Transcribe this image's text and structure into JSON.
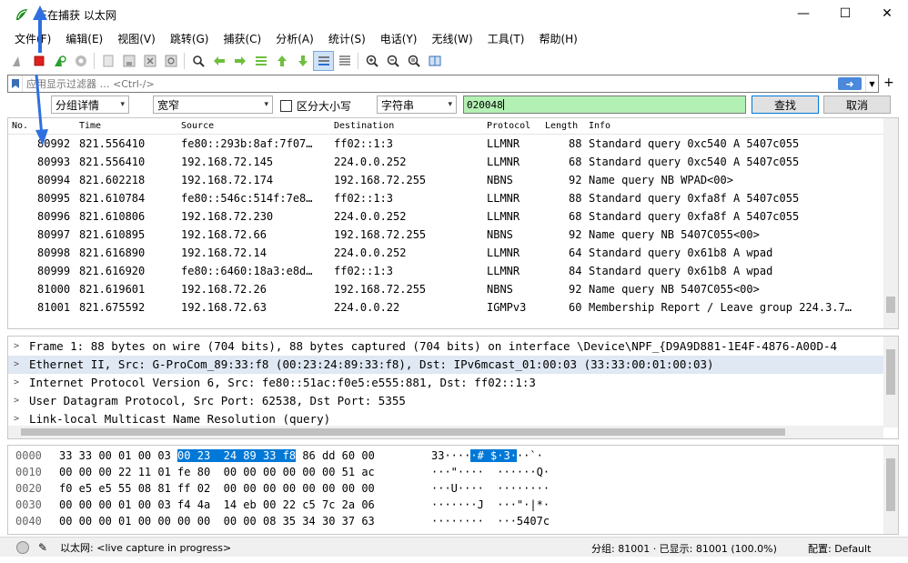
{
  "window": {
    "title": "正在捕获 以太网",
    "controls": [
      "—",
      "☐",
      "✕"
    ]
  },
  "menu": [
    "文件(F)",
    "编辑(E)",
    "视图(V)",
    "跳转(G)",
    "捕获(C)",
    "分析(A)",
    "统计(S)",
    "电话(Y)",
    "无线(W)",
    "工具(T)",
    "帮助(H)"
  ],
  "toolbar_icons": [
    "shark-fin-start-icon",
    "stop-capture-icon",
    "restart-capture-icon",
    "capture-options-icon",
    "open-file-icon",
    "save-file-icon",
    "close-file-icon",
    "reload-file-icon",
    "find-packet-icon",
    "go-back-icon",
    "go-forward-icon",
    "go-to-packet-icon",
    "go-first-icon",
    "go-last-icon",
    "autoscroll-icon",
    "colorize-icon",
    "zoom-in-icon",
    "zoom-out-icon",
    "zoom-normal-icon",
    "resize-columns-icon"
  ],
  "display_filter": {
    "placeholder": "应用显示过滤器 … <Ctrl-/>"
  },
  "find_bar": {
    "search_in": "分组详情",
    "char_width": "宽窄",
    "case_label": "区分大小写",
    "search_type": "字符串",
    "value": "020048",
    "find_button": "查找",
    "cancel_button": "取消"
  },
  "packet_list": {
    "columns": [
      "No.",
      "Time",
      "Source",
      "Destination",
      "Protocol",
      "Length",
      "Info"
    ],
    "rows": [
      {
        "no": "80992",
        "time": "821.556410",
        "src": "fe80::293b:8af:7f07…",
        "dst": "ff02::1:3",
        "proto": "LLMNR",
        "len": "88",
        "info": "Standard query 0xc540 A 5407c055"
      },
      {
        "no": "80993",
        "time": "821.556410",
        "src": "192.168.72.145",
        "dst": "224.0.0.252",
        "proto": "LLMNR",
        "len": "68",
        "info": "Standard query 0xc540 A 5407c055"
      },
      {
        "no": "80994",
        "time": "821.602218",
        "src": "192.168.72.174",
        "dst": "192.168.72.255",
        "proto": "NBNS",
        "len": "92",
        "info": "Name query NB WPAD<00>"
      },
      {
        "no": "80995",
        "time": "821.610784",
        "src": "fe80::546c:514f:7e8…",
        "dst": "ff02::1:3",
        "proto": "LLMNR",
        "len": "88",
        "info": "Standard query 0xfa8f A 5407c055"
      },
      {
        "no": "80996",
        "time": "821.610806",
        "src": "192.168.72.230",
        "dst": "224.0.0.252",
        "proto": "LLMNR",
        "len": "68",
        "info": "Standard query 0xfa8f A 5407c055"
      },
      {
        "no": "80997",
        "time": "821.610895",
        "src": "192.168.72.66",
        "dst": "192.168.72.255",
        "proto": "NBNS",
        "len": "92",
        "info": "Name query NB 5407C055<00>"
      },
      {
        "no": "80998",
        "time": "821.616890",
        "src": "192.168.72.14",
        "dst": "224.0.0.252",
        "proto": "LLMNR",
        "len": "64",
        "info": "Standard query 0x61b8 A wpad"
      },
      {
        "no": "80999",
        "time": "821.616920",
        "src": "fe80::6460:18a3:e8d…",
        "dst": "ff02::1:3",
        "proto": "LLMNR",
        "len": "84",
        "info": "Standard query 0x61b8 A wpad"
      },
      {
        "no": "81000",
        "time": "821.619601",
        "src": "192.168.72.26",
        "dst": "192.168.72.255",
        "proto": "NBNS",
        "len": "92",
        "info": "Name query NB 5407C055<00>"
      },
      {
        "no": "81001",
        "time": "821.675592",
        "src": "192.168.72.63",
        "dst": "224.0.0.22",
        "proto": "IGMPv3",
        "len": "60",
        "info": "Membership Report / Leave group 224.3.7…"
      }
    ]
  },
  "details": [
    "Frame 1: 88 bytes on wire (704 bits), 88 bytes captured (704 bits) on interface \\Device\\NPF_{D9A9D881-1E4F-4876-A00D-4",
    "Ethernet II, Src: G-ProCom_89:33:f8 (00:23:24:89:33:f8), Dst: IPv6mcast_01:00:03 (33:33:00:01:00:03)",
    "Internet Protocol Version 6, Src: fe80::51ac:f0e5:e555:881, Dst: ff02::1:3",
    "User Datagram Protocol, Src Port: 62538, Dst Port: 5355",
    "Link-local Multicast Name Resolution (query)"
  ],
  "bytes": [
    {
      "off": "0000",
      "hex_pre": "33 33 00 01 00 03 ",
      "hex_hl": "00 23  24 89 33 f8",
      "hex_post": " 86 dd 60 00",
      "asc_pre": "33····",
      "asc_hl": "·# $·3·",
      "asc_post": "··`·"
    },
    {
      "off": "0010",
      "hex_pre": "00 00 00 22 11 01 fe 80  00 00 00 00 00 00 51 ac",
      "hex_hl": "",
      "hex_post": "",
      "asc_pre": "···\"····  ······Q·",
      "asc_hl": "",
      "asc_post": ""
    },
    {
      "off": "0020",
      "hex_pre": "f0 e5 e5 55 08 81 ff 02  00 00 00 00 00 00 00 00",
      "hex_hl": "",
      "hex_post": "",
      "asc_pre": "···U····  ········",
      "asc_hl": "",
      "asc_post": ""
    },
    {
      "off": "0030",
      "hex_pre": "00 00 00 01 00 03 f4 4a  14 eb 00 22 c5 7c 2a 06",
      "hex_hl": "",
      "hex_post": "",
      "asc_pre": "·······J  ···\"·|*·",
      "asc_hl": "",
      "asc_post": ""
    },
    {
      "off": "0040",
      "hex_pre": "00 00 00 01 00 00 00 00  00 00 08 35 34 30 37 63",
      "hex_hl": "",
      "hex_post": "",
      "asc_pre": "········  ···5407c",
      "asc_hl": "",
      "asc_post": ""
    }
  ],
  "status": {
    "capture_text": "以太网: <live capture in progress>",
    "packets": "分组: 81001 · 已显示: 81001 (100.0%)",
    "profile": "配置: Default"
  },
  "colors": {
    "find_bg": "#b3f0b3",
    "selection": "#0078d7",
    "annotation": "#2f6fe0",
    "stop_red": "#e02020"
  }
}
